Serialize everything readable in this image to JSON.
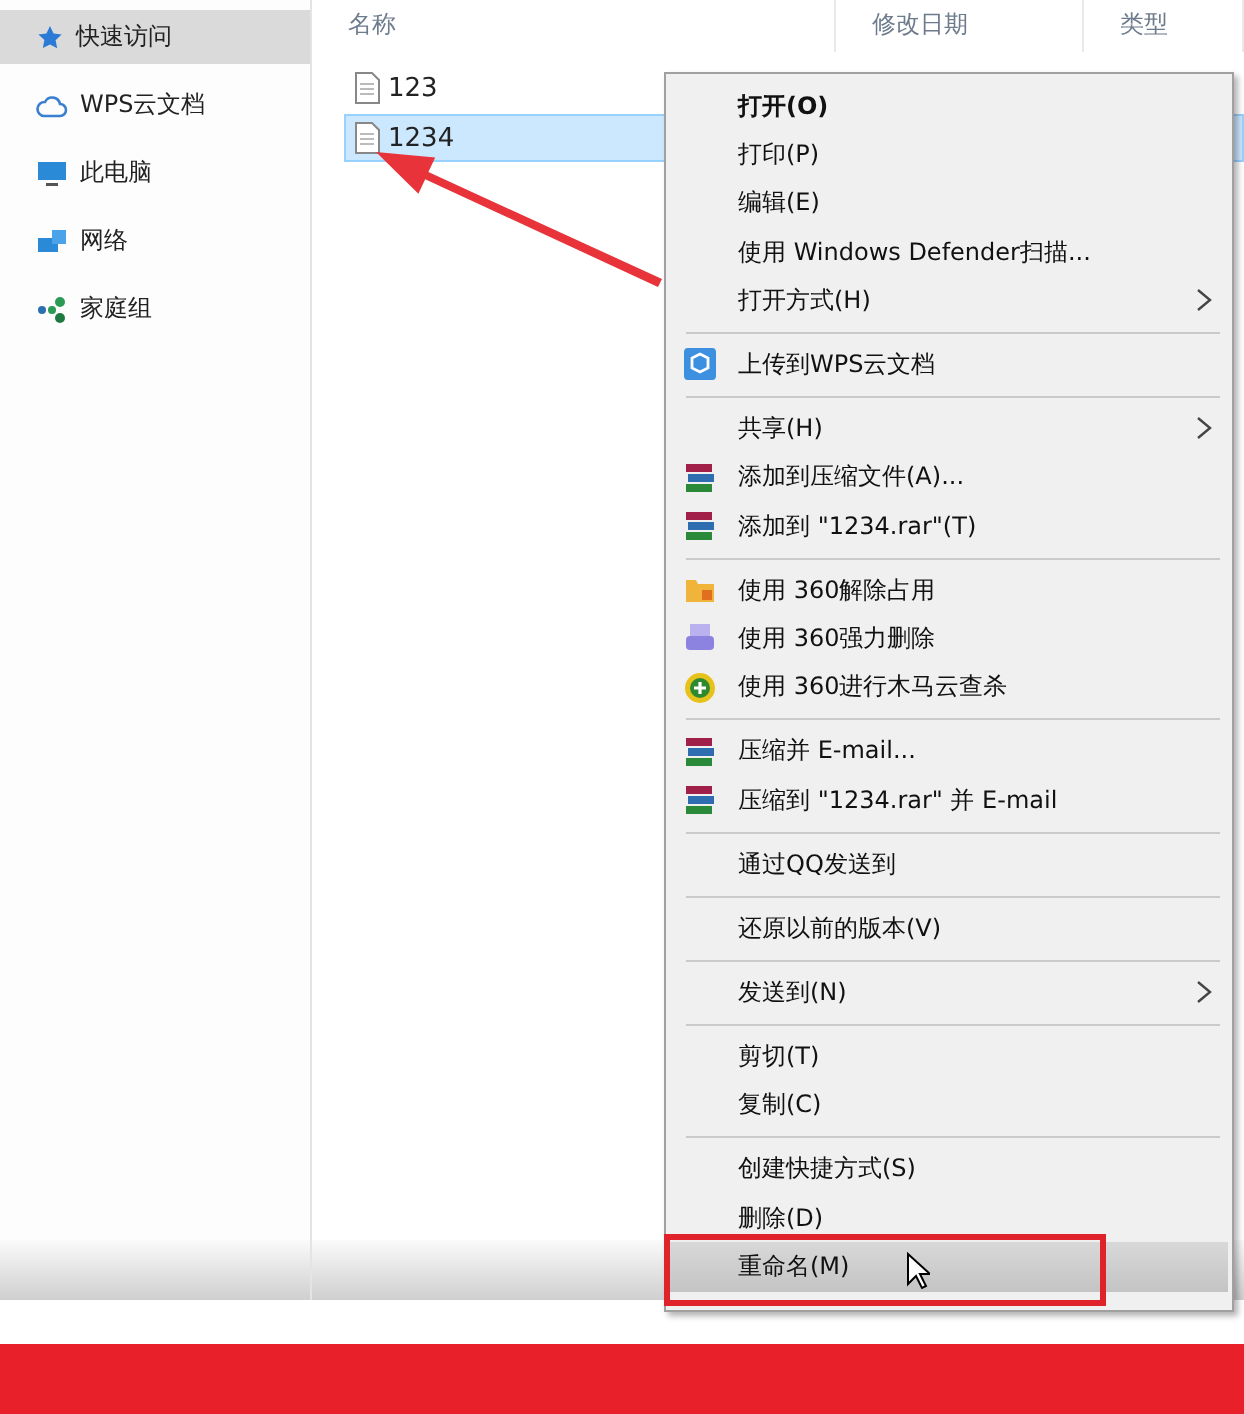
{
  "sidebar": {
    "items": [
      {
        "label": "快速访问",
        "selected": true
      },
      {
        "label": "WPS云文档",
        "selected": false
      },
      {
        "label": "此电脑",
        "selected": false
      },
      {
        "label": "网络",
        "selected": false
      },
      {
        "label": "家庭组",
        "selected": false
      }
    ]
  },
  "file_list": {
    "columns": [
      "名称",
      "修改日期",
      "类型"
    ],
    "files": [
      {
        "name": "123",
        "selected": false,
        "pointed": false
      },
      {
        "name": "1234",
        "selected": true,
        "pointed": true
      }
    ]
  },
  "context_menu": {
    "items": [
      {
        "kind": "text",
        "label": "打开(O)",
        "default": true
      },
      {
        "kind": "text",
        "label": "打印(P)"
      },
      {
        "kind": "text",
        "label": "编辑(E)"
      },
      {
        "kind": "text",
        "label": "使用 Windows Defender扫描..."
      },
      {
        "kind": "text",
        "label": "打开方式(H)",
        "submenu": true
      },
      {
        "kind": "separator"
      },
      {
        "kind": "wps",
        "label": "上传到WPS云文档"
      },
      {
        "kind": "separator"
      },
      {
        "kind": "text",
        "label": "共享(H)",
        "submenu": true
      },
      {
        "kind": "archive",
        "label": "添加到压缩文件(A)..."
      },
      {
        "kind": "archive",
        "label": "添加到 \"1234.rar\"(T)"
      },
      {
        "kind": "separator"
      },
      {
        "kind": "unlock",
        "label": "使用 360解除占用"
      },
      {
        "kind": "shred",
        "label": "使用 360强力删除"
      },
      {
        "kind": "scan",
        "label": "使用 360进行木马云查杀"
      },
      {
        "kind": "separator"
      },
      {
        "kind": "archive",
        "label": "压缩并 E-mail..."
      },
      {
        "kind": "archive",
        "label": "压缩到 \"1234.rar\" 并 E-mail"
      },
      {
        "kind": "separator"
      },
      {
        "kind": "text",
        "label": "通过QQ发送到"
      },
      {
        "kind": "separator"
      },
      {
        "kind": "text",
        "label": "还原以前的版本(V)"
      },
      {
        "kind": "separator"
      },
      {
        "kind": "text",
        "label": "发送到(N)",
        "submenu": true
      },
      {
        "kind": "separator"
      },
      {
        "kind": "text",
        "label": "剪切(T)"
      },
      {
        "kind": "text",
        "label": "复制(C)"
      },
      {
        "kind": "separator"
      },
      {
        "kind": "text",
        "label": "创建快捷方式(S)"
      },
      {
        "kind": "text",
        "label": "删除(D)"
      },
      {
        "kind": "text",
        "label": "重命名(M)",
        "hovered": true,
        "annotated": true
      }
    ]
  }
}
